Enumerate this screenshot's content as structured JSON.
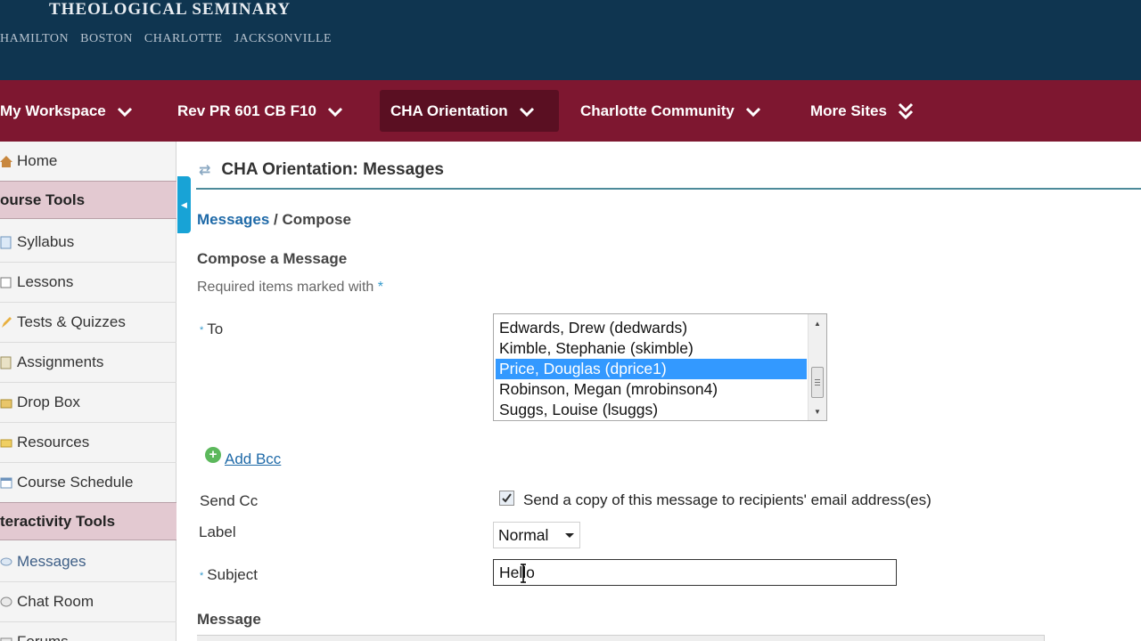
{
  "header": {
    "institution": "THEOLOGICAL SEMINARY",
    "campuses": [
      "HAMILTON",
      "BOSTON",
      "CHARLOTTE",
      "JACKSONVILLE"
    ]
  },
  "site_nav": {
    "tabs": [
      {
        "label": "My Workspace"
      },
      {
        "label": "Rev PR 601 CB F10"
      },
      {
        "label": "CHA Orientation",
        "active": true
      },
      {
        "label": "Charlotte Community"
      },
      {
        "label": "More Sites"
      }
    ]
  },
  "sidebar": {
    "items": [
      {
        "label": "Home",
        "icon": "home-icon"
      },
      {
        "label": "ourse Tools",
        "section": true
      },
      {
        "label": "Syllabus",
        "icon": "syllabus-icon"
      },
      {
        "label": "Lessons",
        "icon": "lessons-icon"
      },
      {
        "label": "Tests & Quizzes",
        "icon": "pencil-icon"
      },
      {
        "label": "Assignments",
        "icon": "assignments-icon"
      },
      {
        "label": "Drop Box",
        "icon": "dropbox-icon"
      },
      {
        "label": "Resources",
        "icon": "folder-icon"
      },
      {
        "label": "Course Schedule",
        "icon": "calendar-icon"
      },
      {
        "label": "teractivity Tools",
        "section": true
      },
      {
        "label": "Messages",
        "icon": "messages-icon",
        "current": true
      },
      {
        "label": "Chat Room",
        "icon": "chat-icon"
      },
      {
        "label": "Forums",
        "icon": "forums-icon"
      }
    ]
  },
  "tool": {
    "title": "CHA Orientation: Messages"
  },
  "breadcrumb": {
    "link": "Messages",
    "separator": " / ",
    "current": "Compose"
  },
  "form": {
    "heading": "Compose a Message",
    "required_note": "Required items marked with ",
    "required_star": "*",
    "to_label": "To",
    "to_options": [
      "Edwards, Drew (dedwards)",
      "Kimble, Stephanie (skimble)",
      "Price, Douglas (dprice1)",
      "Robinson, Megan (mrobinson4)",
      "Suggs, Louise (lsuggs)"
    ],
    "to_selected_index": 2,
    "add_bcc": "Add Bcc",
    "send_cc_label": "Send Cc",
    "send_cc_checked": true,
    "send_cc_text": "Send a copy of this message to recipients' email address(es)",
    "label_label": "Label",
    "label_value": "Normal",
    "subject_label": "Subject",
    "subject_value": "Hello",
    "message_label": "Message"
  },
  "colors": {
    "header_bg": "#0f3550",
    "nav_bg": "#7e1730",
    "nav_active_bg": "#5a0f22",
    "section_bg": "#e3c9d1",
    "link": "#1f6aa8",
    "selected_option": "#3399ff",
    "collapse_tab": "#18a3d6"
  }
}
